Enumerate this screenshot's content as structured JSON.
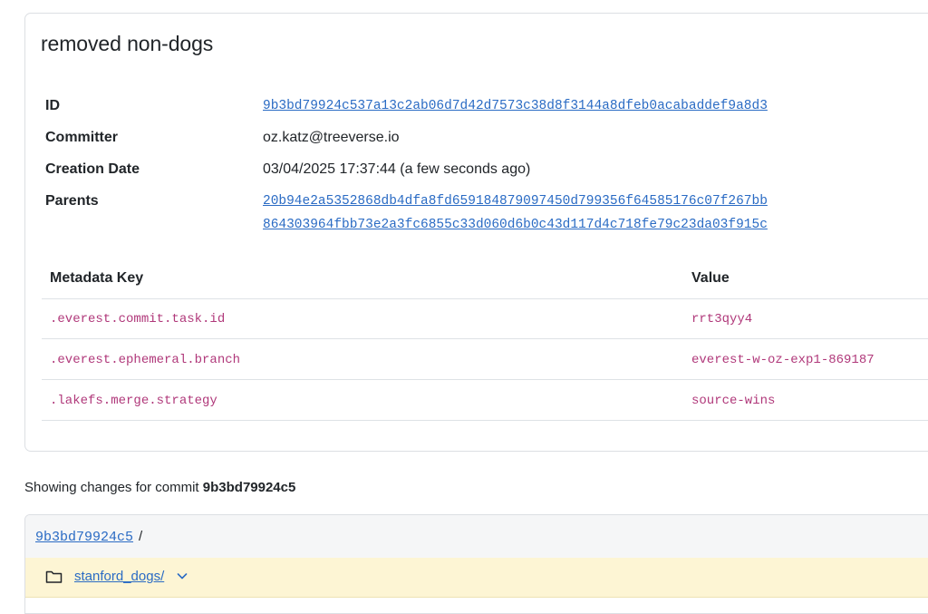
{
  "commit": {
    "title": "removed non-dogs",
    "labels": {
      "id": "ID",
      "committer": "Committer",
      "creation_date": "Creation Date",
      "parents": "Parents"
    },
    "id": "9b3bd79924c537a13c2ab06d7d42d7573c38d8f3144a8dfeb0acabaddef9a8d3",
    "committer": "oz.katz@treeverse.io",
    "creation_date": "03/04/2025 17:37:44 (a few seconds ago)",
    "parents": [
      "20b94e2a5352868db4dfa8fd659184879097450d799356f64585176c07f267bb",
      "864303964fbb73e2a3fc6855c33d060d6b0c43d117d4c718fe79c23da03f915c"
    ]
  },
  "metadata": {
    "headers": {
      "key": "Metadata Key",
      "value": "Value"
    },
    "rows": [
      {
        "key": ".everest.commit.task.id",
        "value": "rrt3qyy4"
      },
      {
        "key": ".everest.ephemeral.branch",
        "value": "everest-w-oz-exp1-869187"
      },
      {
        "key": ".lakefs.merge.strategy",
        "value": "source-wins"
      }
    ]
  },
  "changes": {
    "showing_prefix": "Showing changes for commit",
    "commit_short": "9b3bd79924c5"
  },
  "tree": {
    "breadcrumb_ref": "9b3bd79924c5",
    "breadcrumb_sep": "/",
    "entries": [
      {
        "name": "stanford_dogs/",
        "icon": "folder-icon"
      }
    ]
  },
  "colors": {
    "link": "#2a6bc4",
    "metadata_text": "#b0387a",
    "changed_row_bg": "#fdf5d4"
  }
}
